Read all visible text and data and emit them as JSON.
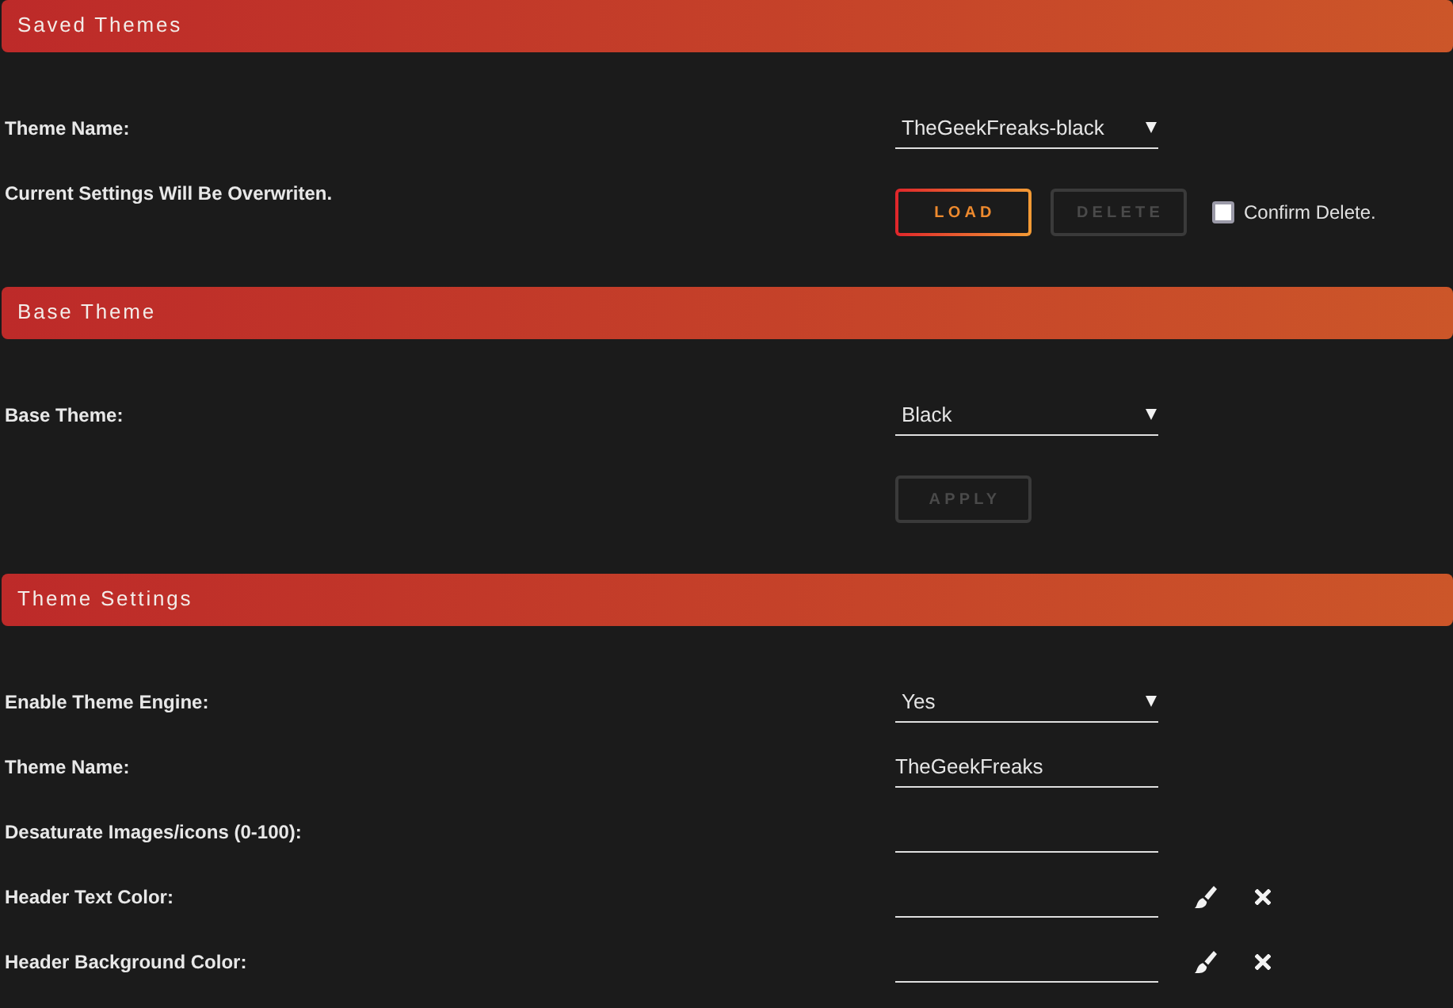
{
  "sections": [
    {
      "title": "Saved Themes",
      "rows": [
        {
          "kind": "select",
          "label": "Theme Name:",
          "value": "TheGeekFreaks-black"
        },
        {
          "kind": "actions",
          "label": "Current Settings Will Be Overwriten.",
          "buttons": [
            {
              "label": "LOAD",
              "disabled": false
            },
            {
              "label": "DELETE",
              "disabled": true
            }
          ],
          "checkbox": {
            "label": "Confirm Delete.",
            "checked": false
          }
        }
      ]
    },
    {
      "title": "Base Theme",
      "rows": [
        {
          "kind": "select",
          "label": "Base Theme:",
          "value": "Black"
        },
        {
          "kind": "actions",
          "buttons": [
            {
              "label": "APPLY",
              "disabled": true
            }
          ]
        }
      ]
    },
    {
      "title": "Theme Settings",
      "rows": [
        {
          "kind": "select",
          "label": "Enable Theme Engine:",
          "value": "Yes"
        },
        {
          "kind": "text",
          "label": "Theme Name:",
          "value": "TheGeekFreaks"
        },
        {
          "kind": "text",
          "label": "Desaturate Images/icons (0-100):"
        },
        {
          "kind": "color",
          "label": "Header Text Color:"
        },
        {
          "kind": "color",
          "label": "Header Background Color:"
        }
      ]
    }
  ]
}
